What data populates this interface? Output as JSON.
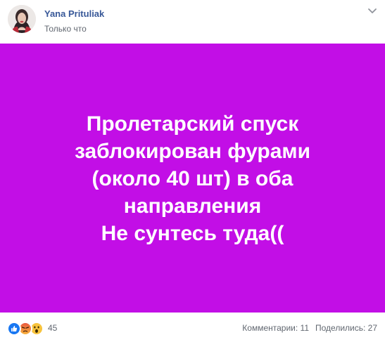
{
  "post": {
    "author": "Yana Prituliak",
    "time": "Только что",
    "banner": {
      "lines": [
        "Пролетарский спуск",
        "заблокирован фурами",
        "(около 40 шт) в оба",
        "направления",
        "Не сунтесь туда(("
      ],
      "background": "#c20ee6",
      "text_color": "#ffffff"
    },
    "footer": {
      "reaction_icons": [
        "like-icon",
        "angry-icon",
        "wow-icon"
      ],
      "reaction_count": "45",
      "comments": "Комментарии: 11",
      "shares": "Поделились: 27"
    }
  }
}
